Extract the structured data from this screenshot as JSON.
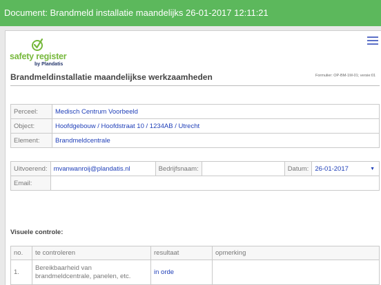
{
  "window": {
    "title": "Document: Brandmeld installatie maandelijks 26-01-2017 12:11:21"
  },
  "logo": {
    "name": "safety register",
    "by": "by Plandatis"
  },
  "header": {
    "heading": "Brandmeldinstallatie maandelijkse werkzaamheden",
    "form_code": "Formulier: OP-BM-1M-01; versie:01"
  },
  "location": [
    {
      "label": "Perceel:",
      "value": "Medisch Centrum Voorbeeld"
    },
    {
      "label": "Object:",
      "value": "Hoofdgebouw / Hoofdstraat 10 / 1234AB / Utrecht"
    },
    {
      "label": "Element:",
      "value": "Brandmeldcentrale"
    }
  ],
  "execution": {
    "uitvoerend_label": "Uitvoerend:",
    "uitvoerend_value": "mvanwanroij@plandatis.nl",
    "bedrijfsnaam_label": "Bedrijfsnaam:",
    "bedrijfsnaam_value": "",
    "datum_label": "Datum:",
    "datum_value": "26-01-2017",
    "email_label": "Email:",
    "email_value": ""
  },
  "visual_check": {
    "title": "Visuele controle:",
    "columns": [
      "no.",
      "te controleren",
      "resultaat",
      "opmerking"
    ],
    "rows": [
      {
        "no": "1.",
        "item": "Bereikbaarheid van brandmeldcentrale, panelen, etc.",
        "result": "in orde",
        "remark": ""
      }
    ]
  },
  "colors": {
    "titlebar": "#5cb85c",
    "value_text": "#1f3fb8",
    "logo_green": "#76b83b",
    "logo_blue": "#23356b"
  },
  "icons": {
    "menu": "hamburger-icon",
    "logo": "check-logo-icon",
    "select": "caret-down-icon"
  }
}
